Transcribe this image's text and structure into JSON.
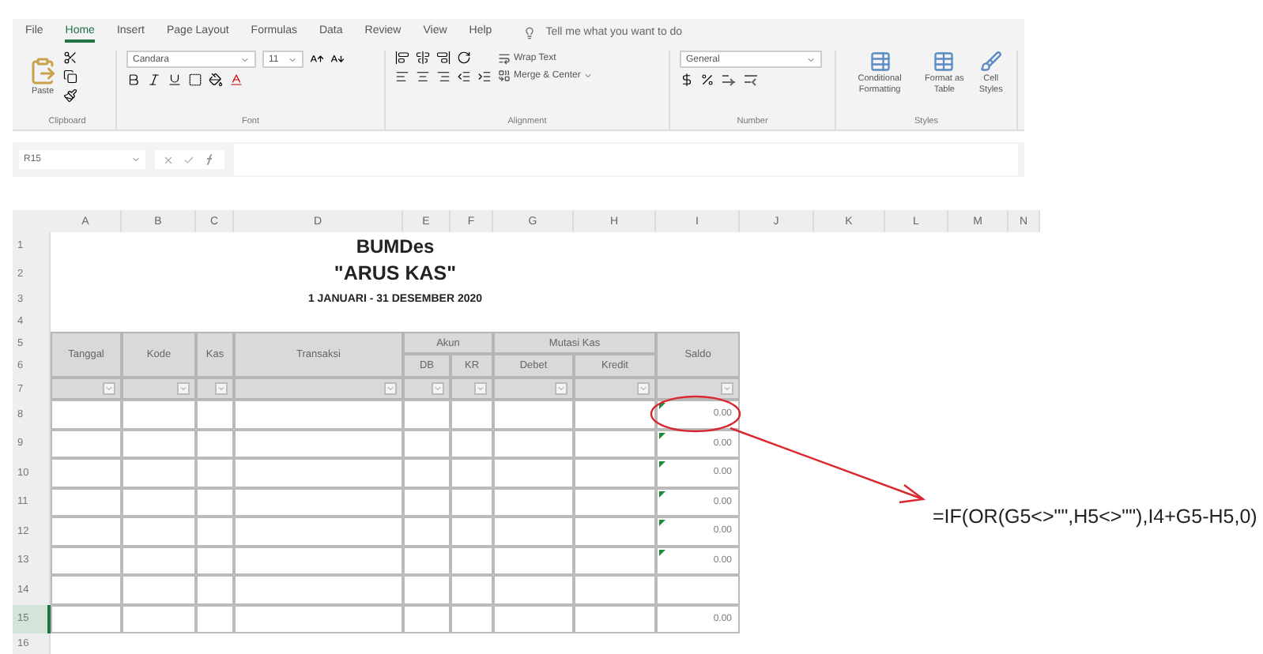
{
  "ribbon": {
    "tabs": [
      {
        "label": "File",
        "selected": false
      },
      {
        "label": "Home",
        "selected": true
      },
      {
        "label": "Insert",
        "selected": false
      },
      {
        "label": "Page Layout",
        "selected": false
      },
      {
        "label": "Formulas",
        "selected": false
      },
      {
        "label": "Data",
        "selected": false
      },
      {
        "label": "Review",
        "selected": false
      },
      {
        "label": "View",
        "selected": false
      },
      {
        "label": "Help",
        "selected": false
      }
    ],
    "tell_me": "Tell me what you want to do",
    "clipboard": {
      "label": "Clipboard",
      "paste": "Paste"
    },
    "font": {
      "label": "Font",
      "name": "Candara",
      "size": "11"
    },
    "alignment": {
      "label": "Alignment",
      "wrap_text": "Wrap Text",
      "merge": "Merge & Center"
    },
    "number": {
      "label": "Number",
      "format": "General"
    },
    "styles": {
      "label": "Styles",
      "buttons": [
        "Conditional Formatting",
        "Format as Table",
        "Cell Styles"
      ]
    }
  },
  "formula_bar": {
    "name_box": "R15"
  },
  "sheet": {
    "columns": [
      {
        "label": "A",
        "selected": false
      },
      {
        "label": "B",
        "selected": false
      },
      {
        "label": "C",
        "selected": false
      },
      {
        "label": "D",
        "selected": false
      },
      {
        "label": "E",
        "selected": false
      },
      {
        "label": "F",
        "selected": false
      },
      {
        "label": "G",
        "selected": false
      },
      {
        "label": "H",
        "selected": false
      },
      {
        "label": "I",
        "selected": false
      },
      {
        "label": "J",
        "selected": false
      },
      {
        "label": "K",
        "selected": false
      },
      {
        "label": "L",
        "selected": false
      },
      {
        "label": "M",
        "selected": false
      },
      {
        "label": "N",
        "selected": false
      }
    ],
    "rows": [
      {
        "label": "1",
        "selected": false
      },
      {
        "label": "2",
        "selected": false
      },
      {
        "label": "3",
        "selected": false
      },
      {
        "label": "4",
        "selected": false
      },
      {
        "label": "5",
        "selected": false
      },
      {
        "label": "6",
        "selected": false
      },
      {
        "label": "7",
        "selected": false
      },
      {
        "label": "8",
        "selected": false
      },
      {
        "label": "9",
        "selected": false
      },
      {
        "label": "10",
        "selected": false
      },
      {
        "label": "11",
        "selected": false
      },
      {
        "label": "12",
        "selected": false
      },
      {
        "label": "13",
        "selected": false
      },
      {
        "label": "14",
        "selected": false
      },
      {
        "label": "15",
        "selected": true
      },
      {
        "label": "16",
        "selected": false
      }
    ]
  },
  "report": {
    "title": "BUMDes",
    "subtitle": "\"ARUS KAS\"",
    "period": "1 JANUARI - 31 DESEMBER 2020"
  },
  "table": {
    "headers": [
      {
        "label": "Tanggal"
      },
      {
        "label": "Kode"
      },
      {
        "label": "Kas"
      },
      {
        "label": "Transaksi"
      },
      {
        "label": "Akun",
        "children": [
          "DB",
          "KR"
        ]
      },
      {
        "label": "Mutasi Kas",
        "children": [
          "Debet",
          "Kredit"
        ]
      },
      {
        "label": "Saldo"
      }
    ],
    "rows": [
      {
        "saldo": "0.00",
        "flagged": true
      },
      {
        "saldo": "0.00",
        "flagged": true
      },
      {
        "saldo": "0.00",
        "flagged": true
      },
      {
        "saldo": "0.00",
        "flagged": true
      },
      {
        "saldo": "0.00",
        "flagged": true
      },
      {
        "saldo": "0.00",
        "flagged": true
      },
      {
        "flagged": false
      },
      {
        "saldo": "0.00",
        "flagged": false
      }
    ]
  },
  "annotation": {
    "formula": "=IF(OR(G5<>\"\",H5<>\"\"),I4+G5-H5,0)"
  }
}
